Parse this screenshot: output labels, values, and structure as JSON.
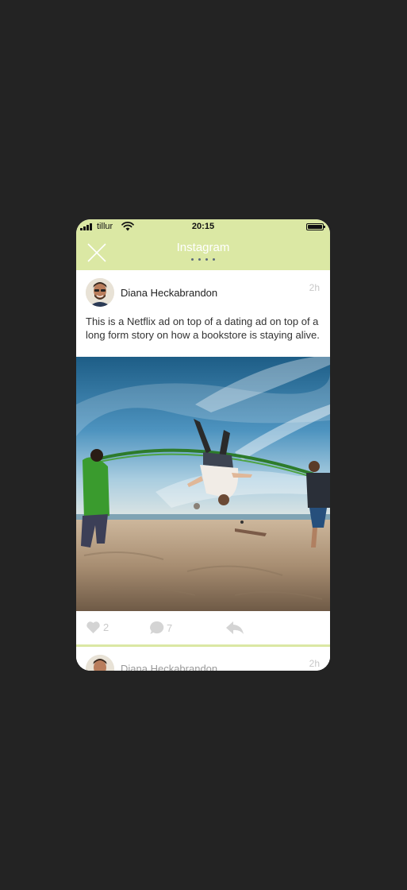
{
  "status_bar": {
    "carrier": "tillur",
    "time": "20:15"
  },
  "header": {
    "title": "Instagram",
    "close_icon": "close-icon",
    "page_dots": 4
  },
  "post": {
    "author": "Diana Heckabrandon",
    "time": "2h",
    "text": "This is a Netflix ad on top of a dating ad on top of a long form story on how a bookstore is staying alive.",
    "actions": {
      "likes": "2",
      "comments": "7"
    }
  },
  "next_post": {
    "author": "Diana Heckabrandon",
    "time": "2h"
  },
  "colors": {
    "accent": "#dbe8a4",
    "background": "#232323"
  }
}
